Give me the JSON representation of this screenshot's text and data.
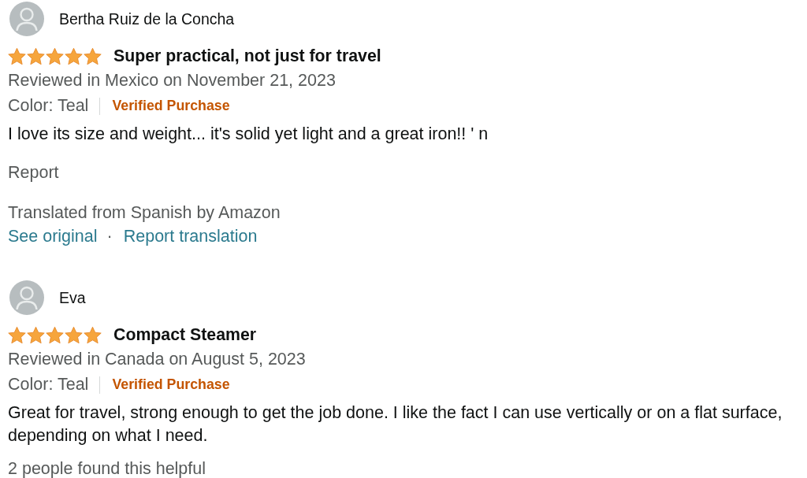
{
  "reviews": [
    {
      "author": "Bertha Ruiz de la Concha",
      "stars": 5,
      "title": "Super practical, not just for travel",
      "reviewed": "Reviewed in Mexico on November 21, 2023",
      "variant": "Color: Teal",
      "badge": "Verified Purchase",
      "body": "I love its size and weight... it's solid yet light and a great iron!! ' n",
      "report": "Report",
      "translation": {
        "note": "Translated from Spanish by Amazon",
        "see_original": "See original",
        "separator": "·",
        "report_translation": "Report translation"
      }
    },
    {
      "author": "Eva",
      "stars": 5,
      "title": "Compact Steamer",
      "reviewed": "Reviewed in Canada on August 5, 2023",
      "variant": "Color: Teal",
      "badge": "Verified Purchase",
      "body": "Great for travel, strong enough to get the job done. I like the fact I can use vertically or on a flat surface, depending on what I need.",
      "helpful": "2 people found this helpful"
    }
  ]
}
